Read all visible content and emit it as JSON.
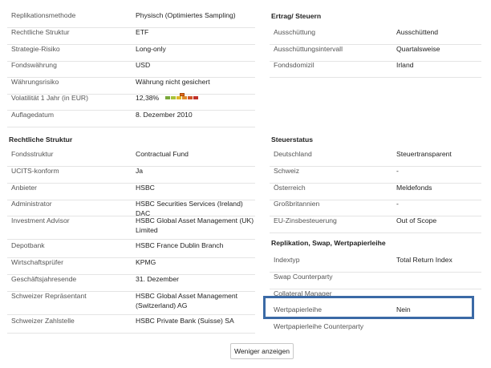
{
  "left": {
    "top_rows": [
      {
        "label": "Replikationsmethode",
        "value": "Physisch (Optimiertes Sampling)"
      },
      {
        "label": "Rechtliche Struktur",
        "value": "ETF"
      },
      {
        "label": "Strategie-Risiko",
        "value": "Long-only"
      },
      {
        "label": "Fondswährung",
        "value": "USD"
      },
      {
        "label": "Währungsrisiko",
        "value": "Währung nicht gesichert"
      },
      {
        "label": "Volatilität 1 Jahr (in EUR)",
        "value": "12,38%"
      },
      {
        "label": "Auflagedatum",
        "value": "8. Dezember 2010"
      }
    ],
    "volatility_indicator": {
      "segments": [
        "#7aa83a",
        "#a8c23a",
        "#e0b82a",
        "#e08a2a",
        "#d0562a",
        "#c0302a"
      ],
      "level_fraction": 0.5
    },
    "legal_section": {
      "title": "Rechtliche Struktur",
      "rows": [
        {
          "label": "Fondsstruktur",
          "value": "Contractual Fund"
        },
        {
          "label": "UCITS-konform",
          "value": "Ja"
        },
        {
          "label": "Anbieter",
          "value": "HSBC"
        },
        {
          "label": "Administrator",
          "value": "HSBC Securities Services (Ireland) DAC"
        },
        {
          "label": "Investment Advisor",
          "value": "HSBC Global Asset Management (UK) Limited"
        },
        {
          "label": "Depotbank",
          "value": "HSBC France Dublin Branch"
        },
        {
          "label": "Wirtschaftsprüfer",
          "value": "KPMG"
        },
        {
          "label": "Geschäftsjahresende",
          "value": "31. Dezember"
        },
        {
          "label": "Schweizer Repräsentant",
          "value": "HSBC Global Asset Management (Switzerland) AG"
        },
        {
          "label": "Schweizer Zahlstelle",
          "value": "HSBC Private Bank (Suisse) SA"
        }
      ]
    }
  },
  "right": {
    "income_section": {
      "title": "Ertrag/ Steuern",
      "rows": [
        {
          "label": "Ausschüttung",
          "value": "Ausschüttend"
        },
        {
          "label": "Ausschüttungsintervall",
          "value": "Quartalsweise"
        },
        {
          "label": "Fondsdomizil",
          "value": "Irland"
        }
      ]
    },
    "tax_section": {
      "title": "Steuerstatus",
      "rows": [
        {
          "label": "Deutschland",
          "value": "Steuertransparent"
        },
        {
          "label": "Schweiz",
          "value": "-"
        },
        {
          "label": "Österreich",
          "value": "Meldefonds"
        },
        {
          "label": "Großbritannien",
          "value": "-"
        },
        {
          "label": "EU-Zinsbesteuerung",
          "value": "Out of Scope"
        }
      ]
    },
    "replication_section": {
      "title": "Replikation, Swap, Wertpapierleihe",
      "rows": [
        {
          "label": "Indextyp",
          "value": "Total Return Index"
        },
        {
          "label": "Swap Counterparty",
          "value": ""
        },
        {
          "label": "Collateral Manager",
          "value": ""
        },
        {
          "label": "Wertpapierleihe",
          "value": "Nein"
        },
        {
          "label": "Wertpapierleihe Counterparty",
          "value": ""
        }
      ]
    }
  },
  "show_less_button": "Weniger anzeigen",
  "colors": {
    "highlight_border": "#3b6aa6",
    "row_border": "#e4e4e4"
  }
}
